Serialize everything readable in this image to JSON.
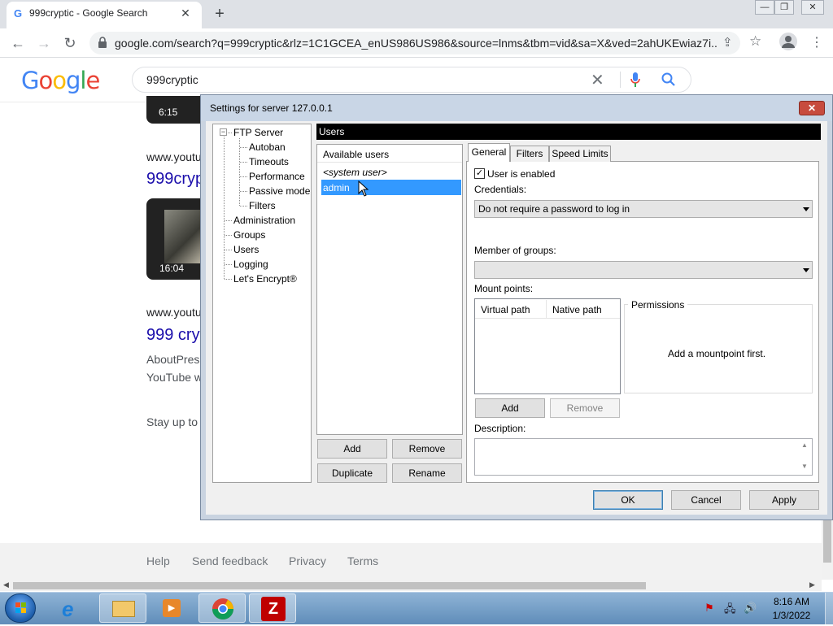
{
  "browser": {
    "tab_title": "999cryptic - Google Search",
    "url": "google.com/search?q=999cryptic&rlz=1C1GCEA_enUS986US986&source=lnms&tbm=vid&sa=X&ved=2ahUKEwiaz7i..."
  },
  "google": {
    "logo": "Google",
    "query": "999cryptic",
    "results": [
      {
        "duration": "6:15"
      },
      {
        "url": "www.youtu",
        "title": "999cryp",
        "duration": "16:04"
      },
      {
        "url": "www.youtu",
        "title": "999 cry",
        "snippet_1": "AboutPres",
        "snippet_2": "YouTube w"
      }
    ],
    "stay_text": "Stay up to",
    "footer": [
      "Help",
      "Send feedback",
      "Privacy",
      "Terms"
    ]
  },
  "dialog": {
    "title": "Settings for server 127.0.0.1",
    "close": "✕",
    "tree": {
      "root": "FTP Server",
      "children": [
        "Autoban",
        "Timeouts",
        "Performance",
        "Passive mode",
        "Filters"
      ],
      "items": [
        "Administration",
        "Groups",
        "Users",
        "Logging",
        "Let's Encrypt®"
      ]
    },
    "section_title": "Users",
    "available_users_label": "Available users",
    "users": [
      "<system user>",
      "admin"
    ],
    "user_buttons": {
      "add": "Add",
      "remove": "Remove",
      "duplicate": "Duplicate",
      "rename": "Rename"
    },
    "tabs": [
      "General",
      "Filters",
      "Speed Limits"
    ],
    "general": {
      "enabled_label": "User is enabled",
      "enabled": true,
      "credentials_label": "Credentials:",
      "credentials_value": "Do not require a password to log in",
      "groups_label": "Member of groups:",
      "groups_value": "",
      "mount_label": "Mount points:",
      "mount_columns": [
        "Virtual path",
        "Native path"
      ],
      "permissions_label": "Permissions",
      "permissions_empty": "Add a mountpoint first.",
      "mount_add": "Add",
      "mount_remove": "Remove",
      "description_label": "Description:"
    },
    "footer_buttons": {
      "ok": "OK",
      "cancel": "Cancel",
      "apply": "Apply"
    }
  },
  "taskbar": {
    "time": "8:16 AM",
    "date": "1/3/2022"
  },
  "colors": {
    "selection": "#3399ff",
    "google_blue": "#4285f4",
    "google_red": "#ea4335",
    "google_yellow": "#fbbc05",
    "google_green": "#34a853"
  }
}
